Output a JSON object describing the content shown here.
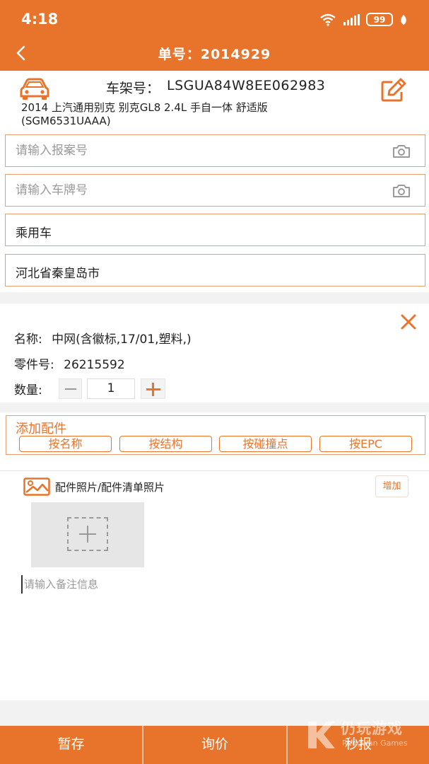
{
  "status_bar": {
    "time": "4:18",
    "battery": "99"
  },
  "header": {
    "title": "单号：2014929"
  },
  "vehicle": {
    "vin_label": "车架号：",
    "vin": "LSGUA84W8EE062983",
    "model_line1": "2014 上汽通用别克 别克GL8 2.4L 手自一体 舒适版",
    "model_line2": "(SGM6531UAAA)"
  },
  "form": {
    "claim_no_placeholder": "请输入报案号",
    "plate_placeholder": "请输入车牌号",
    "vehicle_type": "乘用车",
    "region": "河北省秦皇岛市"
  },
  "part": {
    "name_label": "名称:",
    "name_value": "中网(含徽标,17/01,塑料,)",
    "part_no_label": "零件号:",
    "part_no_value": "26215592",
    "qty_label": "数量:",
    "qty_value": "1"
  },
  "add_parts": {
    "title": "添加配件",
    "buttons": [
      "按名称",
      "按结构",
      "按碰撞点",
      "按EPC"
    ]
  },
  "photos": {
    "label": "配件照片/配件清单照片",
    "add_button": "增加",
    "remark_placeholder": "请输入备注信息"
  },
  "bottom_bar": {
    "save": "暂存",
    "inquiry": "询价",
    "quick_report": "秒报"
  },
  "watermark": {
    "text": "仍玩游戏",
    "subtext": "Rengwan Games"
  },
  "colors": {
    "accent": "#e8742b",
    "border": "#e8a070"
  }
}
